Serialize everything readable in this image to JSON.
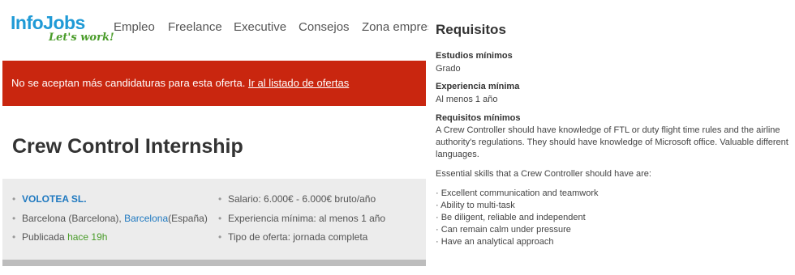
{
  "header": {
    "logo_main": "InfoJobs",
    "logo_sub": "Let's work!",
    "nav": [
      "Empleo",
      "Freelance",
      "Executive",
      "Consejos",
      "Zona empresas"
    ]
  },
  "alert": {
    "message": "No se aceptan más candidaturas para esta oferta.",
    "link": "Ir al listado de ofertas",
    "color": "#c9260f"
  },
  "job": {
    "title": "Crew Control Internship",
    "company": "VOLOTEA SL.",
    "location_prefix": "Barcelona (Barcelona),",
    "location_link": "Barcelona",
    "location_suffix": "(España)",
    "published_prefix": "Publicada",
    "published_link": "hace 19h",
    "salary": "Salario: 6.000€ - 6.000€ bruto/año",
    "experience": "Experiencia mínima: al menos 1 año",
    "offer_type": "Tipo de oferta: jornada completa"
  },
  "requirements": {
    "heading": "Requisitos",
    "studies_label": "Estudios mínimos",
    "studies_value": "Grado",
    "experience_label": "Experiencia mínima",
    "experience_value": "Al menos 1 año",
    "req_label": "Requisitos mínimos",
    "description": "A Crew Controller should have knowledge of FTL or duty flight time rules and the airline authority's regulations. They should have knowledge of Microsoft office. Valuable different languages.",
    "skills_intro": "Essential skills that a Crew Controller should have are:",
    "skills": [
      "· Excellent communication and teamwork",
      "· Ability to multi-task",
      "· Be diligent, reliable and independent",
      "· Can remain calm under pressure",
      "· Have an analytical approach"
    ]
  },
  "colors": {
    "brand_blue": "#1f9ad6",
    "brand_green": "#4a9c2a",
    "link_blue": "#1f79c0"
  }
}
